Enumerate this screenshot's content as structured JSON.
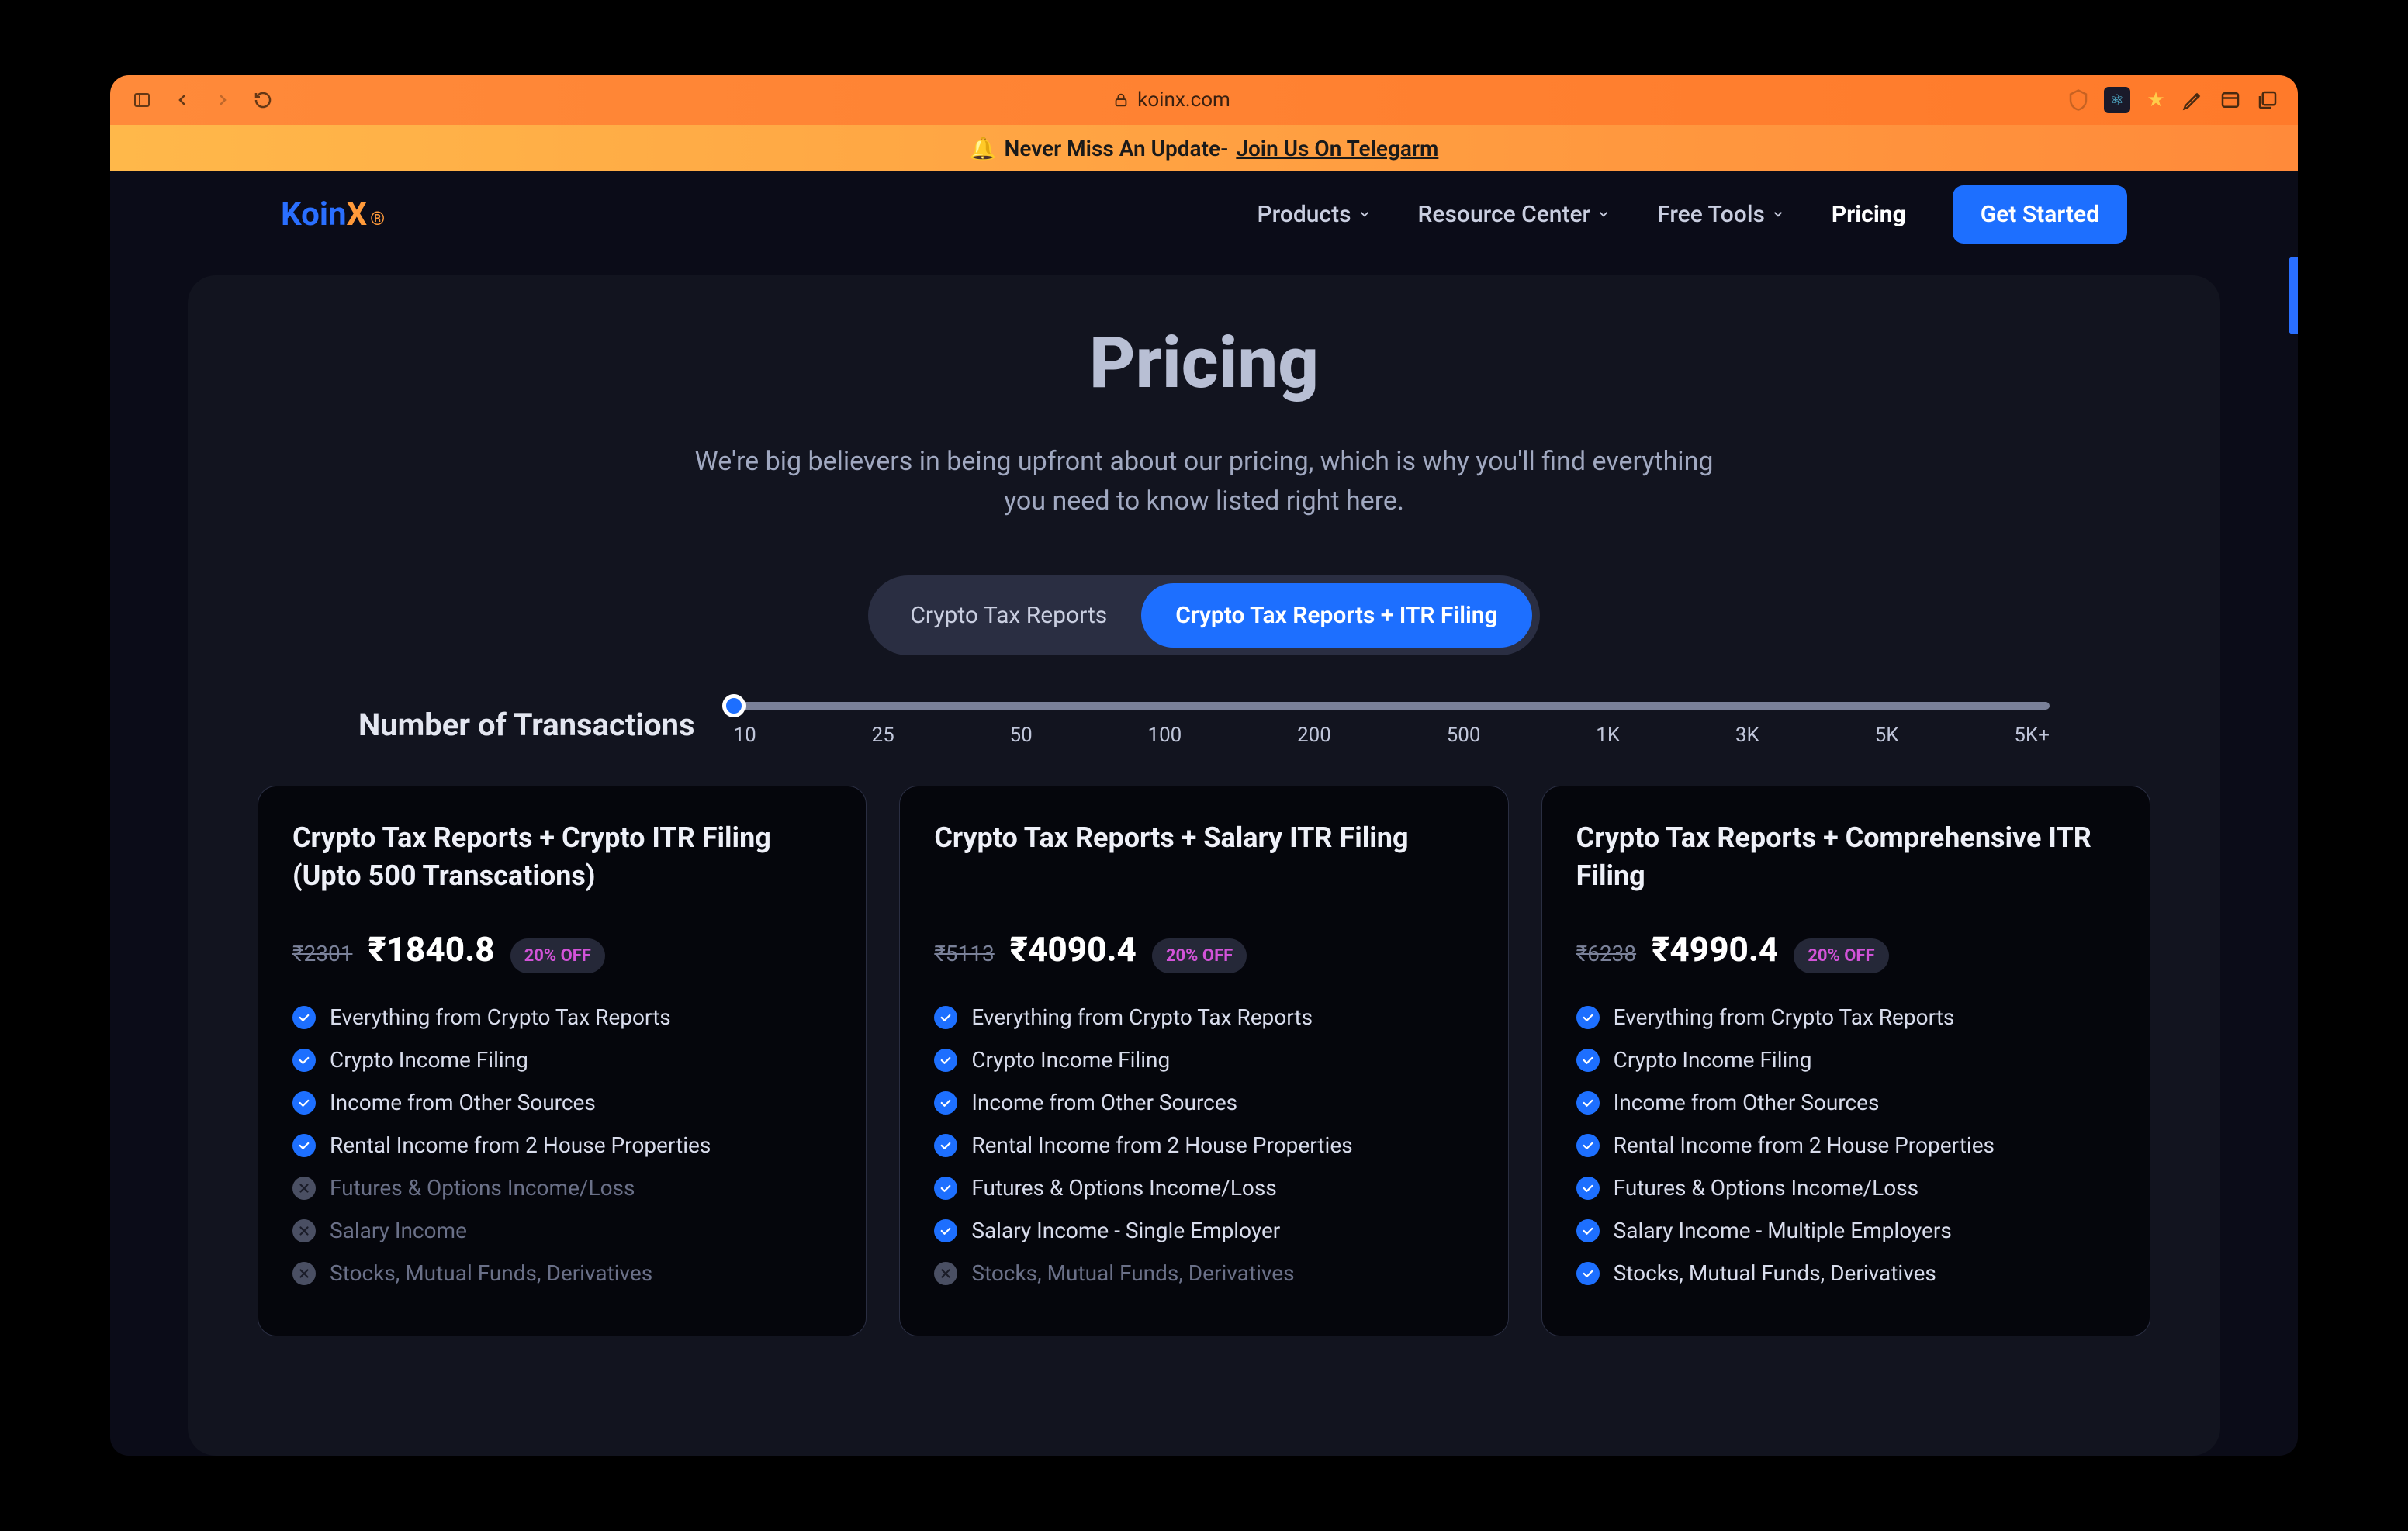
{
  "browser": {
    "url": "koinx.com"
  },
  "banner": {
    "icon": "🔔",
    "text": "Never Miss An Update- ",
    "link": "Join Us On Telegarm"
  },
  "logo": {
    "part1": "Koin",
    "part2": "X"
  },
  "nav": {
    "products": "Products",
    "resource": "Resource Center",
    "tools": "Free Tools",
    "pricing": "Pricing",
    "cta": "Get Started"
  },
  "hero": {
    "title": "Pricing",
    "sub": "We're big believers in being upfront about our pricing, which is why you'll find everything you need to know listed right here."
  },
  "toggle": {
    "opt1": "Crypto Tax Reports",
    "opt2": "Crypto Tax Reports + ITR Filing"
  },
  "slider": {
    "label": "Number of Transactions",
    "ticks": [
      "10",
      "25",
      "50",
      "100",
      "200",
      "500",
      "1K",
      "3K",
      "5K",
      "5K+"
    ]
  },
  "plans": [
    {
      "title": "Crypto Tax Reports + Crypto ITR Filing (Upto 500 Transcations)",
      "old": "₹2301",
      "price": "₹1840.8",
      "badge": "20% OFF",
      "features": [
        {
          "t": "Everything from Crypto Tax Reports",
          "on": true
        },
        {
          "t": "Crypto Income Filing",
          "on": true
        },
        {
          "t": "Income from Other Sources",
          "on": true
        },
        {
          "t": "Rental Income from 2 House Properties",
          "on": true
        },
        {
          "t": "Futures & Options Income/Loss",
          "on": false
        },
        {
          "t": "Salary Income",
          "on": false
        },
        {
          "t": "Stocks, Mutual Funds, Derivatives",
          "on": false
        }
      ]
    },
    {
      "title": "Crypto Tax Reports + Salary ITR Filing",
      "old": "₹5113",
      "price": "₹4090.4",
      "badge": "20% OFF",
      "features": [
        {
          "t": "Everything from Crypto Tax Reports",
          "on": true
        },
        {
          "t": "Crypto Income Filing",
          "on": true
        },
        {
          "t": "Income from Other Sources",
          "on": true
        },
        {
          "t": "Rental Income from 2 House Properties",
          "on": true
        },
        {
          "t": "Futures & Options Income/Loss",
          "on": true
        },
        {
          "t": "Salary Income - Single Employer",
          "on": true
        },
        {
          "t": "Stocks, Mutual Funds, Derivatives",
          "on": false
        }
      ]
    },
    {
      "title": "Crypto Tax Reports + Comprehensive ITR Filing",
      "old": "₹6238",
      "price": "₹4990.4",
      "badge": "20% OFF",
      "features": [
        {
          "t": "Everything from Crypto Tax Reports",
          "on": true
        },
        {
          "t": "Crypto Income Filing",
          "on": true
        },
        {
          "t": "Income from Other Sources",
          "on": true
        },
        {
          "t": "Rental Income from 2 House Properties",
          "on": true
        },
        {
          "t": "Futures & Options Income/Loss",
          "on": true
        },
        {
          "t": "Salary Income - Multiple Employers",
          "on": true
        },
        {
          "t": "Stocks, Mutual Funds, Derivatives",
          "on": true
        }
      ]
    }
  ]
}
